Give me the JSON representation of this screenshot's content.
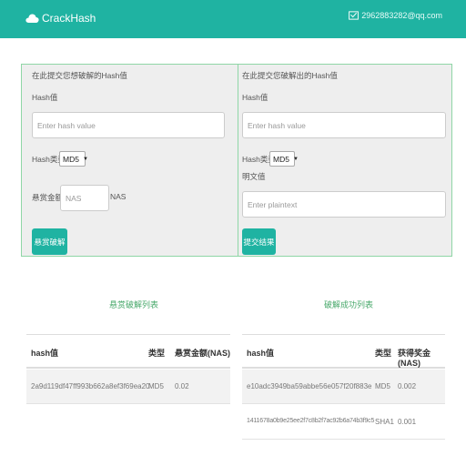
{
  "header": {
    "brand": "CrackHash",
    "email": "2962883282@qq.com",
    "cloud_icon": "cloud-icon",
    "email_icon": "envelope-icon",
    "bg_color": "#1fb3a2"
  },
  "submit_panel": {
    "title": "在此提交您想破解的Hash值",
    "hash_label": "Hash值",
    "hash_placeholder": "Enter hash value",
    "type_label": "Hash类型",
    "type_selected": "MD5",
    "bounty_label": "悬赏金额",
    "bounty_placeholder": "NAS",
    "bounty_unit": "NAS",
    "button": "悬赏破解"
  },
  "result_panel": {
    "title": "在此提交您破解出的Hash值",
    "hash_label": "Hash值",
    "hash_placeholder": "Enter hash value",
    "type_label": "Hash类型",
    "type_selected": "MD5",
    "plaintext_label": "明文值",
    "plaintext_placeholder": "Enter plaintext",
    "button": "提交结果"
  },
  "bounty_list": {
    "title": "悬赏破解列表",
    "headers": [
      "hash值",
      "类型",
      "悬赏金额(NAS)"
    ],
    "rows": [
      [
        "2a9d119df47ff993b662a8ef3f69ea20",
        "MD5",
        "0.02"
      ]
    ]
  },
  "success_list": {
    "title": "破解成功列表",
    "headers": [
      "hash值",
      "类型",
      "获得奖金(NAS)"
    ],
    "rows": [
      [
        "e10adc3949ba59abbe56e057f20f883e",
        "MD5",
        "0.002"
      ],
      [
        "1411678a0b9e25ee2f7c8b2f7ac92b6a74b3f9c5",
        "SHA1",
        "0.001"
      ]
    ]
  }
}
